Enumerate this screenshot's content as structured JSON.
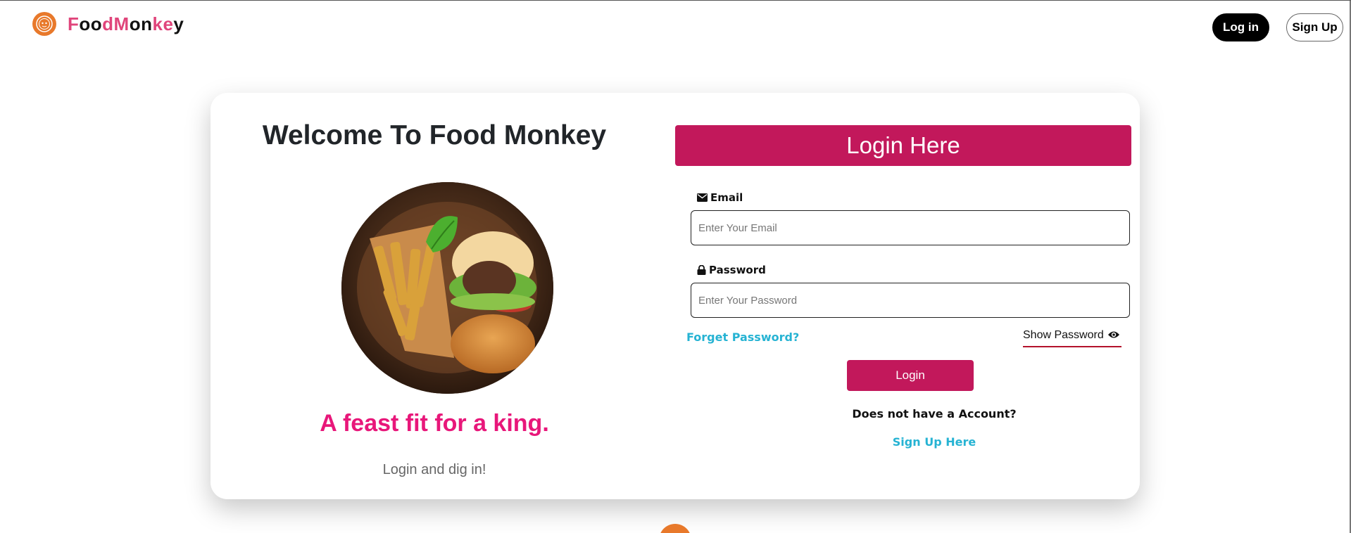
{
  "navbar": {
    "brand_name_parts": [
      "F",
      "oo",
      "d",
      "M",
      "on",
      "ke",
      "y"
    ],
    "login_label": "Log in",
    "signup_label": "Sign Up"
  },
  "left_panel": {
    "welcome_title": "Welcome To Food Monkey",
    "tagline": "A feast fit for a king.",
    "subline": "Login and dig in!"
  },
  "form": {
    "header": "Login Here",
    "email_label": "Email",
    "email_placeholder": "Enter Your Email",
    "email_value": "",
    "password_label": "Password",
    "password_placeholder": "Enter Your Password",
    "password_value": "",
    "forget_password": "Forget Password?",
    "show_password": "Show Password",
    "login_button": "Login",
    "no_account": "Does not have a Account?",
    "signup_link": "Sign Up Here"
  },
  "colors": {
    "primary": "#c2185b",
    "tagline": "#e8177a",
    "link": "#26b3d3",
    "logo": "#e8792b"
  },
  "icons": {
    "brand": "monkey-logo-icon",
    "email": "envelope-icon",
    "password": "lock-icon",
    "show_password": "eye-icon"
  }
}
